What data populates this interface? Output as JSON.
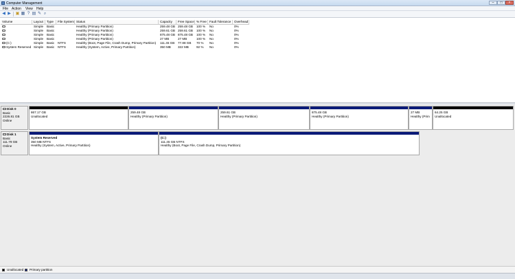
{
  "window": {
    "title": "Computer Management",
    "min": "–",
    "max": "□",
    "close": "×"
  },
  "menu": [
    "File",
    "Action",
    "View",
    "Help"
  ],
  "toolbar": [
    "◀",
    "▶",
    "▣",
    "▦",
    "?",
    "▤",
    "✎",
    "⌕"
  ],
  "volumes": {
    "headers": [
      "Volume",
      "Layout",
      "Type",
      "File System",
      "Status",
      "Capacity",
      "Free Space",
      "% Free",
      "Fault Tolerance",
      "Overhead"
    ],
    "rows": [
      [
        "",
        "Simple",
        "Basic",
        "",
        "Healthy (Primary Partition)",
        "259.48 GB",
        "259.48 GB",
        "100 %",
        "No",
        "0%"
      ],
      [
        "",
        "Simple",
        "Basic",
        "",
        "Healthy (Primary Partition)",
        "259.61 GB",
        "259.61 GB",
        "100 %",
        "No",
        "0%"
      ],
      [
        "",
        "Simple",
        "Basic",
        "",
        "Healthy (Primary Partition)",
        "875.48 GB",
        "875.48 GB",
        "100 %",
        "No",
        "0%"
      ],
      [
        "",
        "Simple",
        "Basic",
        "",
        "Healthy (Primary Partition)",
        "27 MB",
        "27 MB",
        "100 %",
        "No",
        "0%"
      ],
      [
        "(C:)",
        "Simple",
        "Basic",
        "NTFS",
        "Healthy (Boot, Page File, Crash Dump, Primary Partition)",
        "111.45 GB",
        "77.88 GB",
        "70 %",
        "No",
        "0%"
      ],
      [
        "System Reserved",
        "Simple",
        "Basic",
        "NTFS",
        "Healthy (System, Active, Primary Partition)",
        "350 MB",
        "322 MB",
        "92 %",
        "No",
        "0%"
      ]
    ]
  },
  "disks": [
    {
      "name": "Disk 0",
      "type": "Basic",
      "size": "2226.81 GB",
      "state": "Online",
      "partitions": [
        {
          "title": "",
          "size": "867.17 GB",
          "status": "Unallocated",
          "kind": "unallocated"
        },
        {
          "title": "",
          "size": "259.48 GB",
          "status": "Healthy (Primary Partition)",
          "kind": "primary"
        },
        {
          "title": "",
          "size": "259.61 GB",
          "status": "Healthy (Primary Partition)",
          "kind": "primary"
        },
        {
          "title": "",
          "size": "875.48 GB",
          "status": "Healthy (Primary Partition)",
          "kind": "primary"
        },
        {
          "title": "",
          "size": "27 MB",
          "status": "Healthy (Prim",
          "kind": "primary"
        },
        {
          "title": "",
          "size": "64.25 GB",
          "status": "Unallocated",
          "kind": "unallocated"
        }
      ]
    },
    {
      "name": "Disk 1",
      "type": "Basic",
      "size": "111.79 GB",
      "state": "Online",
      "partitions": [
        {
          "title": "System Reserved",
          "size": "350 MB NTFS",
          "status": "Healthy (System, Active, Primary Partition)",
          "kind": "primary"
        },
        {
          "title": "(C:)",
          "size": "111.45 GB NTFS",
          "status": "Healthy (Boot, Page File, Crash Dump, Primary Partition)",
          "kind": "primary"
        }
      ]
    }
  ],
  "legend": [
    {
      "label": "Unallocated",
      "color": "#000000"
    },
    {
      "label": "Primary partition",
      "color": "#0a1a78"
    }
  ],
  "colors": {
    "primary": "#0a1a78",
    "unallocated": "#000000"
  }
}
